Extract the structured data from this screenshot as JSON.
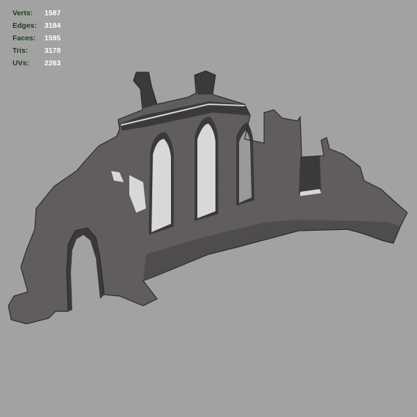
{
  "viewport": {
    "background": "#a2a2a2",
    "label_color": "#1e3d1e",
    "value_color": "#ffffff",
    "model": {
      "face_color": "#5e5e5e",
      "dark_color": "#3a3a3a",
      "light_color": "#d8d8d8",
      "edge_color": "#8a4a52"
    }
  },
  "stats": [
    {
      "label": "Verts:",
      "value": "1587"
    },
    {
      "label": "Edges:",
      "value": "3184"
    },
    {
      "label": "Faces:",
      "value": "1595"
    },
    {
      "label": "Tris:",
      "value": "3178"
    },
    {
      "label": "UVs:",
      "value": "2263"
    }
  ]
}
